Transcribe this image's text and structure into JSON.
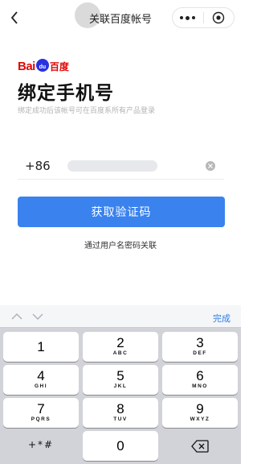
{
  "nav": {
    "title": "关联百度帐号",
    "back_icon": "chevron-left-icon",
    "more_icon": "more-dots-icon",
    "close_icon": "target-close-icon"
  },
  "brand": {
    "logo_bai": "Bai",
    "logo_paw": "du",
    "logo_cn": "百度",
    "brand_red": "#e10602",
    "brand_blue": "#2932e1"
  },
  "page": {
    "heading": "绑定手机号",
    "subtitle": "绑定成功后该帐号可在百度系所有产品登录"
  },
  "phone": {
    "country_code": "+86",
    "value": "",
    "clear_icon": "clear-circle-icon"
  },
  "actions": {
    "get_code_label": "获取验证码",
    "button_color": "#3a82ee",
    "alt_login_label": "通过用户名密码关联"
  },
  "keyboard": {
    "done_label": "完成",
    "done_color": "#2b7ce9",
    "prev_icon": "chevron-up-icon",
    "next_icon": "chevron-down-icon",
    "keys": [
      {
        "digit": "1",
        "letters": ""
      },
      {
        "digit": "2",
        "letters": "ABC"
      },
      {
        "digit": "3",
        "letters": "DEF"
      },
      {
        "digit": "4",
        "letters": "GHI"
      },
      {
        "digit": "5",
        "letters": "JKL"
      },
      {
        "digit": "6",
        "letters": "MNO"
      },
      {
        "digit": "7",
        "letters": "PQRS"
      },
      {
        "digit": "8",
        "letters": "TUV"
      },
      {
        "digit": "9",
        "letters": "WXYZ"
      }
    ],
    "symbols_label": "+*#",
    "zero": "0",
    "delete_icon": "backspace-icon"
  }
}
